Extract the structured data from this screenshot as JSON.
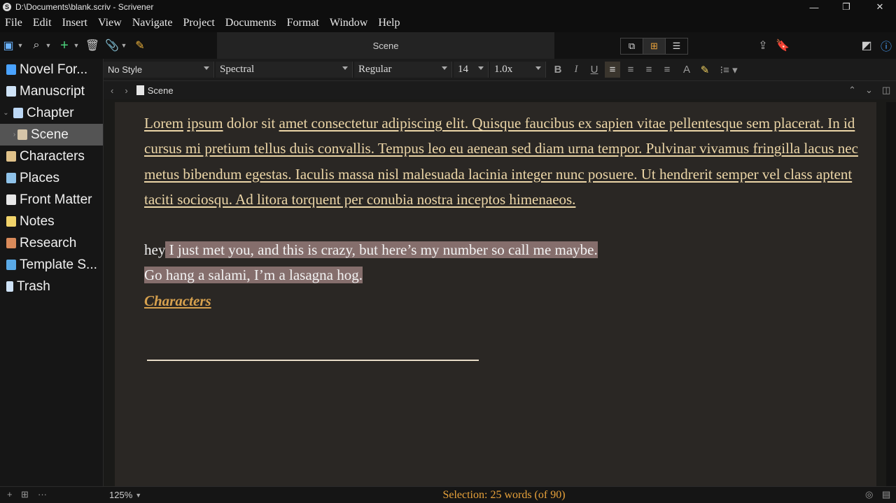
{
  "titlebar": {
    "title": "D:\\Documents\\blank.scriv - Scrivener"
  },
  "menu": [
    "File",
    "Edit",
    "Insert",
    "View",
    "Navigate",
    "Project",
    "Documents",
    "Format",
    "Window",
    "Help"
  ],
  "toolbar": {
    "center_title": "Scene"
  },
  "binder": {
    "items": [
      {
        "label": "Novel For..."
      },
      {
        "label": "Manuscript"
      },
      {
        "label": "Chapter"
      },
      {
        "label": "Scene"
      },
      {
        "label": "Characters"
      },
      {
        "label": "Places"
      },
      {
        "label": "Front Matter"
      },
      {
        "label": "Notes"
      },
      {
        "label": "Research"
      },
      {
        "label": "Template S..."
      },
      {
        "label": "Trash"
      }
    ]
  },
  "format": {
    "style": "No Style",
    "font": "Spectral",
    "weight": "Regular",
    "size": "14",
    "spacing": "1.0x"
  },
  "nav": {
    "doc_title": "Scene"
  },
  "editor": {
    "p1_a": "Lorem",
    "p1_b": "ipsum",
    "p1_c": " dolor sit ",
    "p1_rest": "amet consectetur adipiscing elit. Quisque faucibus ex sapien vitae pellentesque sem placerat. In id cursus mi pretium tellus duis convallis. Tempus leo eu aenean sed diam urna tempor. Pulvinar vivamus fringilla lacus nec metus bibendum egestas. Iaculis massa nisl malesuada lacinia integer nunc posuere. Ut hendrerit semper vel class aptent taciti sociosqu. Ad litora torquent per conubia nostra inceptos himenaeos.",
    "line2_pre": "hey",
    "line2_sel": " I just met you, and this is crazy, but here’s my number so call me maybe.  ",
    "line3": "Go hang a salami, I’m a lasagna hog.",
    "link": "Characters"
  },
  "footer": {
    "zoom": "125%",
    "status": "Selection: 25 words (of 90)"
  },
  "colors": {
    "accent": "#e8a23a",
    "text": "#ecd6a7",
    "highlight": "#856e6c"
  }
}
